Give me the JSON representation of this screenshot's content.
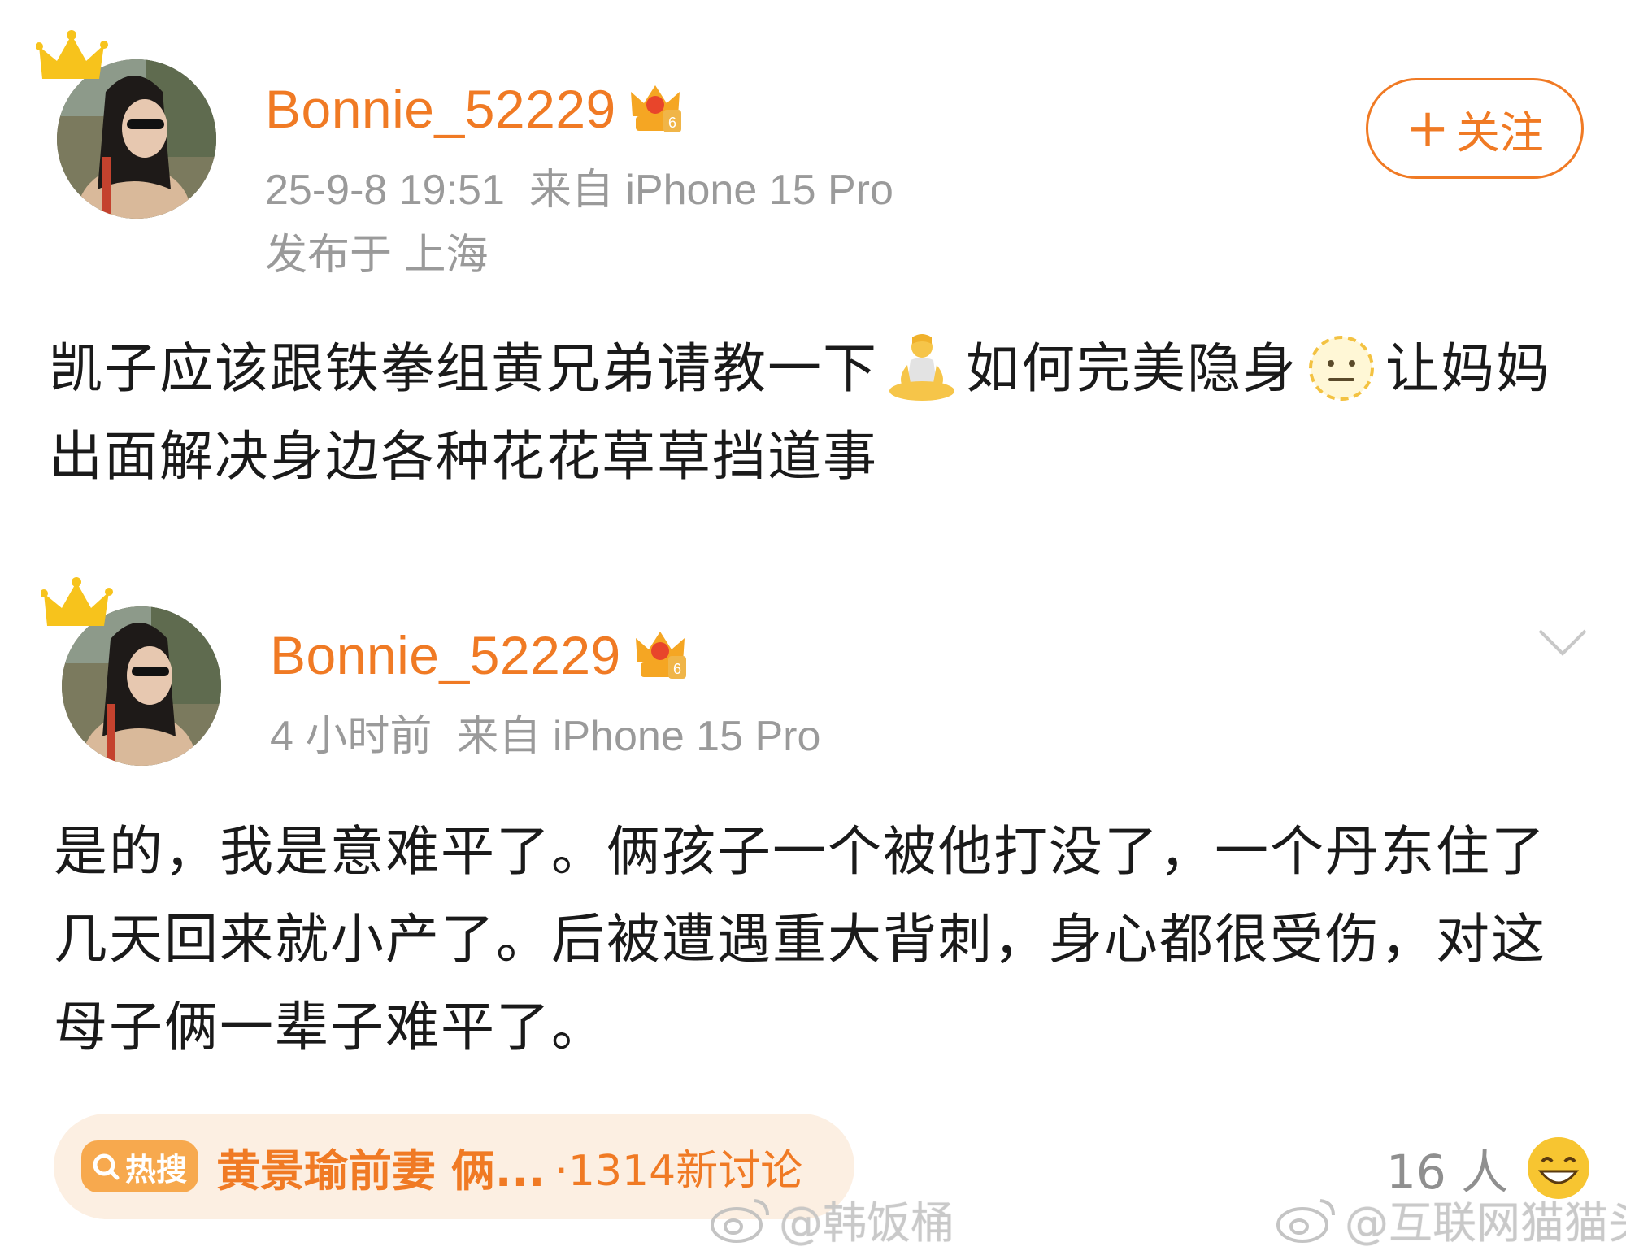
{
  "posts": [
    {
      "username": "Bonnie_52229",
      "time": "25-9-8 19:51",
      "source": "来自 iPhone 15 Pro",
      "location": "发布于 上海",
      "follow_label": "关注",
      "text_part1": "凯子应该跟铁拳组黄兄弟请教一下",
      "text_part2": "如何完美隐身",
      "text_part3": "让妈妈出面解决身边各种花花草草挡道事"
    },
    {
      "username": "Bonnie_52229",
      "time": "4 小时前",
      "source": "来自 iPhone 15 Pro",
      "text": "是的，我是意难平了。俩孩子一个被他打没了，一个丹东住了几天回来就小产了。后被遭遇重大背刺，身心都很受伤，对这母子俩一辈子难平了。"
    }
  ],
  "hot_search": {
    "tag": "热搜",
    "title": "黄景瑜前妻 俩...",
    "count": "·1314新讨论"
  },
  "reactions": {
    "count": "16 人"
  },
  "watermarks": {
    "left": "@韩饭桶",
    "right": "@互联网猫猫头"
  },
  "icons": {
    "emoji1": "meditation-person-icon",
    "emoji2": "expressionless-dashed-face-icon",
    "react": "grinning-face-icon",
    "badge": "vip-crown-badge-icon",
    "menu": "chevron-down-icon"
  },
  "colors": {
    "accent": "#f07a24",
    "meta": "#9a9a9a",
    "hot_bg": "#fcefe2"
  }
}
